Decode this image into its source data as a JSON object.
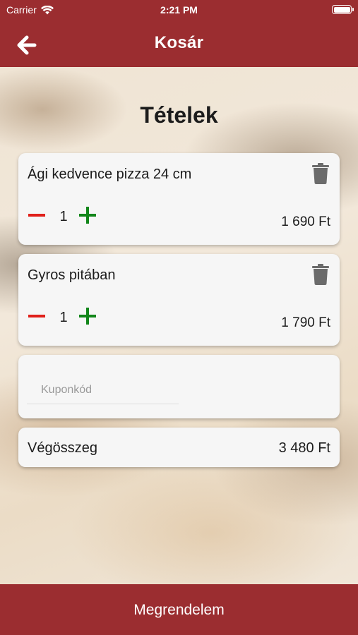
{
  "status_bar": {
    "carrier": "Carrier",
    "time": "2:21 PM"
  },
  "header": {
    "title": "Kosár",
    "back_icon": "arrow-left-icon"
  },
  "page": {
    "heading": "Tételek"
  },
  "items": [
    {
      "name": "Ági kedvence pizza 24 cm",
      "quantity": "1",
      "price": "1 690 Ft"
    },
    {
      "name": "Gyros pitában",
      "quantity": "1",
      "price": "1 790 Ft"
    }
  ],
  "coupon": {
    "placeholder": "Kuponkód",
    "value": ""
  },
  "total": {
    "label": "Végösszeg",
    "value": "3 480 Ft"
  },
  "order_button": {
    "label": "Megrendelem"
  },
  "colors": {
    "brand": "#9b2d30",
    "minus": "#e0201a",
    "plus": "#12861a",
    "trash": "#6b6b6b"
  }
}
